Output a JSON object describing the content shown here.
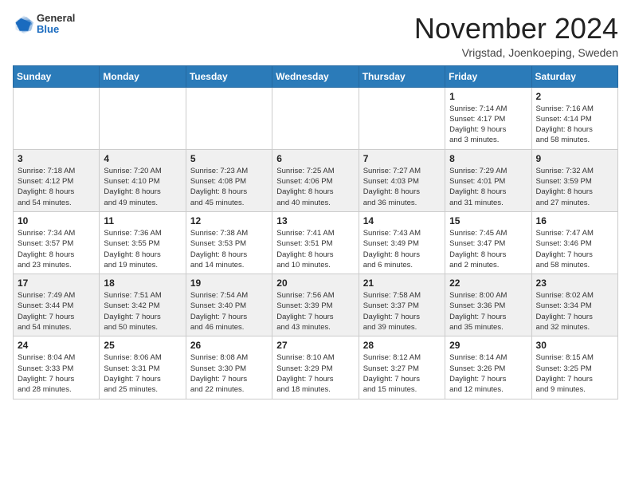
{
  "header": {
    "logo_general": "General",
    "logo_blue": "Blue",
    "month_title": "November 2024",
    "location": "Vrigstad, Joenkoeping, Sweden"
  },
  "days_of_week": [
    "Sunday",
    "Monday",
    "Tuesday",
    "Wednesday",
    "Thursday",
    "Friday",
    "Saturday"
  ],
  "weeks": [
    [
      {
        "day": "",
        "info": ""
      },
      {
        "day": "",
        "info": ""
      },
      {
        "day": "",
        "info": ""
      },
      {
        "day": "",
        "info": ""
      },
      {
        "day": "",
        "info": ""
      },
      {
        "day": "1",
        "info": "Sunrise: 7:14 AM\nSunset: 4:17 PM\nDaylight: 9 hours\nand 3 minutes."
      },
      {
        "day": "2",
        "info": "Sunrise: 7:16 AM\nSunset: 4:14 PM\nDaylight: 8 hours\nand 58 minutes."
      }
    ],
    [
      {
        "day": "3",
        "info": "Sunrise: 7:18 AM\nSunset: 4:12 PM\nDaylight: 8 hours\nand 54 minutes."
      },
      {
        "day": "4",
        "info": "Sunrise: 7:20 AM\nSunset: 4:10 PM\nDaylight: 8 hours\nand 49 minutes."
      },
      {
        "day": "5",
        "info": "Sunrise: 7:23 AM\nSunset: 4:08 PM\nDaylight: 8 hours\nand 45 minutes."
      },
      {
        "day": "6",
        "info": "Sunrise: 7:25 AM\nSunset: 4:06 PM\nDaylight: 8 hours\nand 40 minutes."
      },
      {
        "day": "7",
        "info": "Sunrise: 7:27 AM\nSunset: 4:03 PM\nDaylight: 8 hours\nand 36 minutes."
      },
      {
        "day": "8",
        "info": "Sunrise: 7:29 AM\nSunset: 4:01 PM\nDaylight: 8 hours\nand 31 minutes."
      },
      {
        "day": "9",
        "info": "Sunrise: 7:32 AM\nSunset: 3:59 PM\nDaylight: 8 hours\nand 27 minutes."
      }
    ],
    [
      {
        "day": "10",
        "info": "Sunrise: 7:34 AM\nSunset: 3:57 PM\nDaylight: 8 hours\nand 23 minutes."
      },
      {
        "day": "11",
        "info": "Sunrise: 7:36 AM\nSunset: 3:55 PM\nDaylight: 8 hours\nand 19 minutes."
      },
      {
        "day": "12",
        "info": "Sunrise: 7:38 AM\nSunset: 3:53 PM\nDaylight: 8 hours\nand 14 minutes."
      },
      {
        "day": "13",
        "info": "Sunrise: 7:41 AM\nSunset: 3:51 PM\nDaylight: 8 hours\nand 10 minutes."
      },
      {
        "day": "14",
        "info": "Sunrise: 7:43 AM\nSunset: 3:49 PM\nDaylight: 8 hours\nand 6 minutes."
      },
      {
        "day": "15",
        "info": "Sunrise: 7:45 AM\nSunset: 3:47 PM\nDaylight: 8 hours\nand 2 minutes."
      },
      {
        "day": "16",
        "info": "Sunrise: 7:47 AM\nSunset: 3:46 PM\nDaylight: 7 hours\nand 58 minutes."
      }
    ],
    [
      {
        "day": "17",
        "info": "Sunrise: 7:49 AM\nSunset: 3:44 PM\nDaylight: 7 hours\nand 54 minutes."
      },
      {
        "day": "18",
        "info": "Sunrise: 7:51 AM\nSunset: 3:42 PM\nDaylight: 7 hours\nand 50 minutes."
      },
      {
        "day": "19",
        "info": "Sunrise: 7:54 AM\nSunset: 3:40 PM\nDaylight: 7 hours\nand 46 minutes."
      },
      {
        "day": "20",
        "info": "Sunrise: 7:56 AM\nSunset: 3:39 PM\nDaylight: 7 hours\nand 43 minutes."
      },
      {
        "day": "21",
        "info": "Sunrise: 7:58 AM\nSunset: 3:37 PM\nDaylight: 7 hours\nand 39 minutes."
      },
      {
        "day": "22",
        "info": "Sunrise: 8:00 AM\nSunset: 3:36 PM\nDaylight: 7 hours\nand 35 minutes."
      },
      {
        "day": "23",
        "info": "Sunrise: 8:02 AM\nSunset: 3:34 PM\nDaylight: 7 hours\nand 32 minutes."
      }
    ],
    [
      {
        "day": "24",
        "info": "Sunrise: 8:04 AM\nSunset: 3:33 PM\nDaylight: 7 hours\nand 28 minutes."
      },
      {
        "day": "25",
        "info": "Sunrise: 8:06 AM\nSunset: 3:31 PM\nDaylight: 7 hours\nand 25 minutes."
      },
      {
        "day": "26",
        "info": "Sunrise: 8:08 AM\nSunset: 3:30 PM\nDaylight: 7 hours\nand 22 minutes."
      },
      {
        "day": "27",
        "info": "Sunrise: 8:10 AM\nSunset: 3:29 PM\nDaylight: 7 hours\nand 18 minutes."
      },
      {
        "day": "28",
        "info": "Sunrise: 8:12 AM\nSunset: 3:27 PM\nDaylight: 7 hours\nand 15 minutes."
      },
      {
        "day": "29",
        "info": "Sunrise: 8:14 AM\nSunset: 3:26 PM\nDaylight: 7 hours\nand 12 minutes."
      },
      {
        "day": "30",
        "info": "Sunrise: 8:15 AM\nSunset: 3:25 PM\nDaylight: 7 hours\nand 9 minutes."
      }
    ]
  ]
}
